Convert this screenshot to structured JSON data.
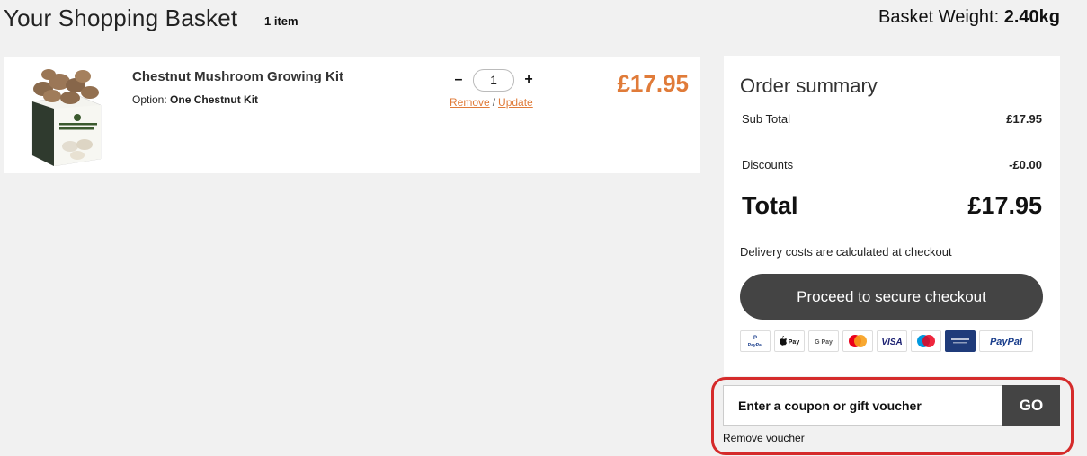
{
  "header": {
    "title": "Your Shopping Basket",
    "item_count": "1 item",
    "weight_label": "Basket Weight:",
    "weight_value": "2.40kg"
  },
  "basket": {
    "items": [
      {
        "name": "Chestnut Mushroom Growing Kit",
        "option_label": "Option:",
        "option_value": "One Chestnut Kit",
        "image_caption": "Ready-to-grow Chestnut Mushrooms",
        "quantity": "1",
        "decrement": "–",
        "increment": "+",
        "remove_label": "Remove",
        "separator": "/",
        "update_label": "Update",
        "price": "£17.95"
      }
    ]
  },
  "summary": {
    "title": "Order summary",
    "subtotal_label": "Sub Total",
    "subtotal_value": "£17.95",
    "discounts_label": "Discounts",
    "discounts_value": "-£0.00",
    "total_label": "Total",
    "total_value": "£17.95",
    "delivery_note": "Delivery costs are calculated at checkout",
    "checkout_label": "Proceed to secure checkout",
    "payment_methods": [
      {
        "name": "paypal-icon",
        "label": "PayPal"
      },
      {
        "name": "apple-pay-icon",
        "label": "Pay"
      },
      {
        "name": "google-pay-icon",
        "label": "G Pay"
      },
      {
        "name": "mastercard-icon",
        "label": ""
      },
      {
        "name": "visa-icon",
        "label": "VISA"
      },
      {
        "name": "maestro-icon",
        "label": ""
      },
      {
        "name": "amex-icon",
        "label": ""
      },
      {
        "name": "paypal-wordmark-icon",
        "label": "PayPal"
      }
    ]
  },
  "coupon": {
    "placeholder": "Enter a coupon or gift voucher",
    "go_label": "GO",
    "remove_voucher_label": "Remove voucher"
  },
  "colors": {
    "accent": "#e07b39",
    "dark_button": "#444444",
    "highlight": "#d52b2b",
    "background": "#f1f1f1"
  }
}
